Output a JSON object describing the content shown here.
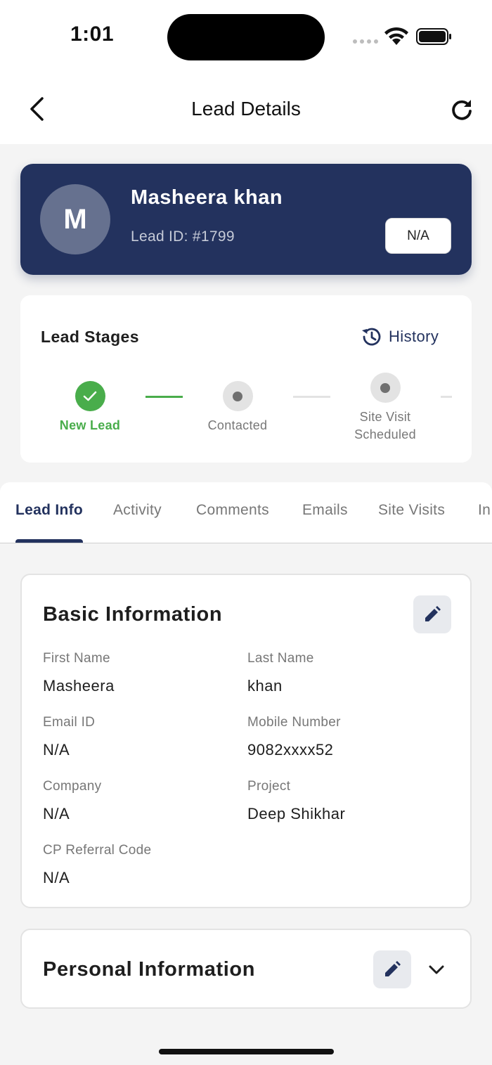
{
  "status_bar": {
    "time": "1:01"
  },
  "header": {
    "title": "Lead Details"
  },
  "lead": {
    "avatar_initial": "M",
    "name": "Masheera khan",
    "lead_id": "Lead ID: #1799",
    "status": "N/A"
  },
  "stages": {
    "title": "Lead Stages",
    "history_label": "History",
    "items": [
      {
        "label": "New Lead",
        "state": "done"
      },
      {
        "label": "Contacted",
        "state": "todo"
      },
      {
        "label": "Site Visit\nScheduled",
        "state": "todo"
      }
    ]
  },
  "tabs": [
    {
      "label": "Lead Info",
      "active": true
    },
    {
      "label": "Activity",
      "active": false
    },
    {
      "label": "Comments",
      "active": false
    },
    {
      "label": "Emails",
      "active": false
    },
    {
      "label": "Site Visits",
      "active": false
    },
    {
      "label": "In",
      "active": false
    }
  ],
  "basic_info": {
    "title": "Basic Information",
    "fields": [
      {
        "label": "First Name",
        "value": "Masheera"
      },
      {
        "label": "Last Name",
        "value": "khan"
      },
      {
        "label": "Email ID",
        "value": "N/A"
      },
      {
        "label": "Mobile Number",
        "value": "9082xxxx52"
      },
      {
        "label": "Company",
        "value": "N/A"
      },
      {
        "label": "Project",
        "value": "Deep Shikhar"
      },
      {
        "label": "CP Referral Code",
        "value": "N/A"
      }
    ]
  },
  "personal_info": {
    "title": "Personal Information"
  },
  "colors": {
    "primary": "#23325e",
    "success": "#49ad4b",
    "background": "#f4f4f4"
  },
  "icons": {
    "back": "chevron-left-icon",
    "refresh": "refresh-icon",
    "history": "history-icon",
    "check": "check-icon",
    "edit": "pencil-icon",
    "expand": "chevron-down-icon"
  }
}
